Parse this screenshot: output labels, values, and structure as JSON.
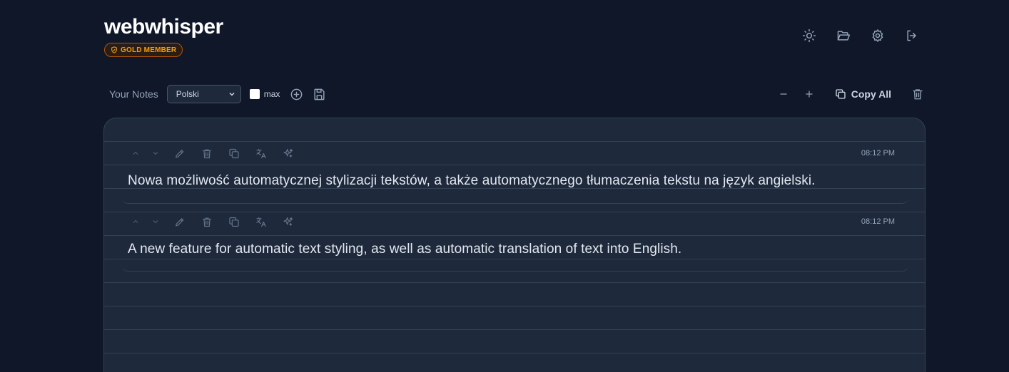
{
  "app": {
    "title": "webwhisper",
    "badge": "GOLD MEMBER"
  },
  "top_icons": [
    "sun-icon",
    "folder-open-icon",
    "gear-icon",
    "logout-icon"
  ],
  "toolbar": {
    "notes_label": "Your Notes",
    "language_selected": "Polski",
    "max_label": "max",
    "max_checked": false,
    "zoom_out": "−",
    "zoom_in": "+",
    "copy_all_label": "Copy All"
  },
  "notes": [
    {
      "time": "08:12 PM",
      "text": "Nowa możliwość automatycznej stylizacji tekstów, a także automatycznego tłumaczenia tekstu na język angielski."
    },
    {
      "time": "08:12 PM",
      "text": "A new feature for automatic text styling, as well as automatic translation of text into English."
    }
  ],
  "colors": {
    "background": "#0f1729",
    "panel": "#1e293b",
    "badge_accent": "#f59e0b"
  }
}
